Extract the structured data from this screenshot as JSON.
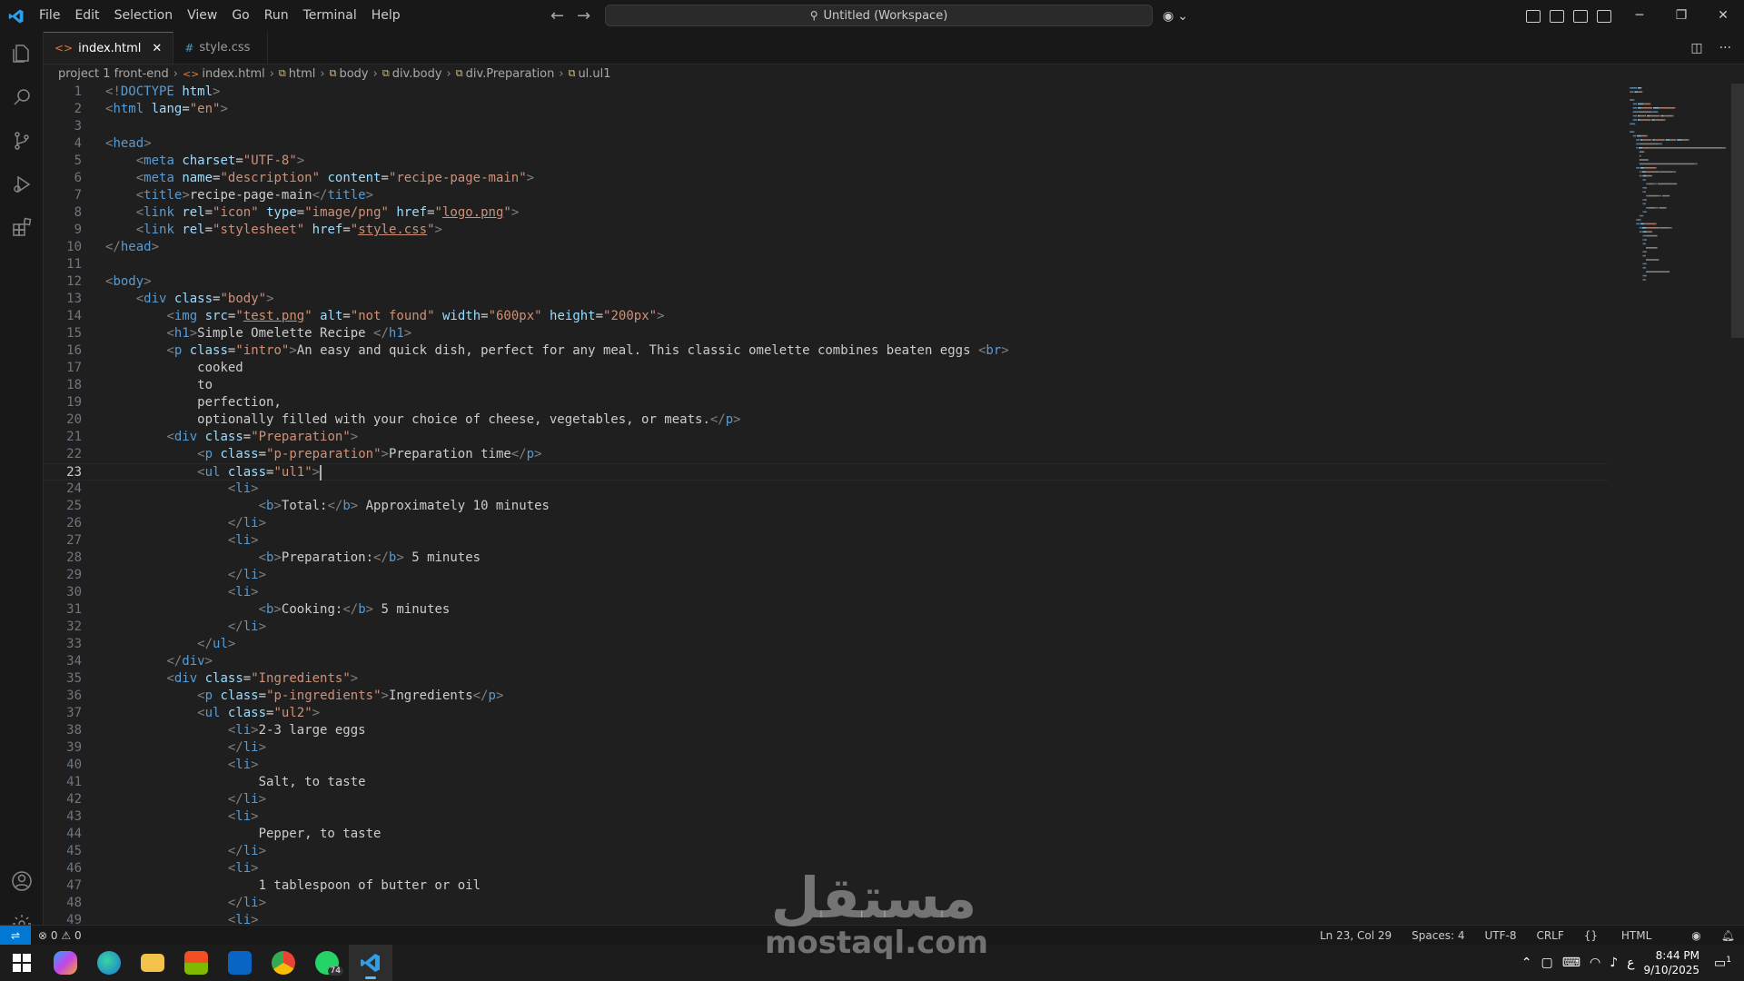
{
  "menu": [
    "File",
    "Edit",
    "Selection",
    "View",
    "Go",
    "Run",
    "Terminal",
    "Help"
  ],
  "command_center": "Untitled (Workspace)",
  "tabs": [
    {
      "label": "index.html",
      "icon": "html-file-icon",
      "active": true
    },
    {
      "label": "style.css",
      "icon": "css-file-icon",
      "active": false
    }
  ],
  "breadcrumb": [
    "project 1 front-end",
    "index.html",
    "html",
    "body",
    "div.body",
    "div.Preparation",
    "ul.ul1"
  ],
  "editor": {
    "cursor_line": 23,
    "lines": [
      [
        [
          "brk",
          "<!"
        ],
        [
          "tag",
          "DOCTYPE"
        ],
        [
          "txt",
          " "
        ],
        [
          "attr",
          "html"
        ],
        [
          "brk",
          ">"
        ]
      ],
      [
        [
          "brk",
          "<"
        ],
        [
          "tag",
          "html"
        ],
        [
          "txt",
          " "
        ],
        [
          "attr",
          "lang"
        ],
        [
          "txt",
          "="
        ],
        [
          "str",
          "\"en\""
        ],
        [
          "brk",
          ">"
        ]
      ],
      [],
      [
        [
          "brk",
          "<"
        ],
        [
          "tag",
          "head"
        ],
        [
          "brk",
          ">"
        ]
      ],
      [
        [
          "txt",
          "    "
        ],
        [
          "brk",
          "<"
        ],
        [
          "tag",
          "meta"
        ],
        [
          "txt",
          " "
        ],
        [
          "attr",
          "charset"
        ],
        [
          "txt",
          "="
        ],
        [
          "str",
          "\"UTF-8\""
        ],
        [
          "brk",
          ">"
        ]
      ],
      [
        [
          "txt",
          "    "
        ],
        [
          "brk",
          "<"
        ],
        [
          "tag",
          "meta"
        ],
        [
          "txt",
          " "
        ],
        [
          "attr",
          "name"
        ],
        [
          "txt",
          "="
        ],
        [
          "str",
          "\"description\""
        ],
        [
          "txt",
          " "
        ],
        [
          "attr",
          "content"
        ],
        [
          "txt",
          "="
        ],
        [
          "str",
          "\"recipe-page-main\""
        ],
        [
          "brk",
          ">"
        ]
      ],
      [
        [
          "txt",
          "    "
        ],
        [
          "brk",
          "<"
        ],
        [
          "tag",
          "title"
        ],
        [
          "brk",
          ">"
        ],
        [
          "txt",
          "recipe-page-main"
        ],
        [
          "brk",
          "</"
        ],
        [
          "tag",
          "title"
        ],
        [
          "brk",
          ">"
        ]
      ],
      [
        [
          "txt",
          "    "
        ],
        [
          "brk",
          "<"
        ],
        [
          "tag",
          "link"
        ],
        [
          "txt",
          " "
        ],
        [
          "attr",
          "rel"
        ],
        [
          "txt",
          "="
        ],
        [
          "str",
          "\"icon\""
        ],
        [
          "txt",
          " "
        ],
        [
          "attr",
          "type"
        ],
        [
          "txt",
          "="
        ],
        [
          "str",
          "\"image/png\""
        ],
        [
          "txt",
          " "
        ],
        [
          "attr",
          "href"
        ],
        [
          "txt",
          "="
        ],
        [
          "str",
          "\""
        ],
        [
          "link",
          "logo.png"
        ],
        [
          "str",
          "\""
        ],
        [
          "brk",
          ">"
        ]
      ],
      [
        [
          "txt",
          "    "
        ],
        [
          "brk",
          "<"
        ],
        [
          "tag",
          "link"
        ],
        [
          "txt",
          " "
        ],
        [
          "attr",
          "rel"
        ],
        [
          "txt",
          "="
        ],
        [
          "str",
          "\"stylesheet\""
        ],
        [
          "txt",
          " "
        ],
        [
          "attr",
          "href"
        ],
        [
          "txt",
          "="
        ],
        [
          "str",
          "\""
        ],
        [
          "link",
          "style.css"
        ],
        [
          "str",
          "\""
        ],
        [
          "brk",
          ">"
        ]
      ],
      [
        [
          "brk",
          "</"
        ],
        [
          "tag",
          "head"
        ],
        [
          "brk",
          ">"
        ]
      ],
      [],
      [
        [
          "brk",
          "<"
        ],
        [
          "tag",
          "body"
        ],
        [
          "brk",
          ">"
        ]
      ],
      [
        [
          "txt",
          "    "
        ],
        [
          "brk",
          "<"
        ],
        [
          "tag",
          "div"
        ],
        [
          "txt",
          " "
        ],
        [
          "attr",
          "class"
        ],
        [
          "txt",
          "="
        ],
        [
          "str",
          "\"body\""
        ],
        [
          "brk",
          ">"
        ]
      ],
      [
        [
          "txt",
          "        "
        ],
        [
          "brk",
          "<"
        ],
        [
          "tag",
          "img"
        ],
        [
          "txt",
          " "
        ],
        [
          "attr",
          "src"
        ],
        [
          "txt",
          "="
        ],
        [
          "str",
          "\""
        ],
        [
          "link",
          "test.png"
        ],
        [
          "str",
          "\""
        ],
        [
          "txt",
          " "
        ],
        [
          "attr",
          "alt"
        ],
        [
          "txt",
          "="
        ],
        [
          "str",
          "\"not found\""
        ],
        [
          "txt",
          " "
        ],
        [
          "attr",
          "width"
        ],
        [
          "txt",
          "="
        ],
        [
          "str",
          "\"600px\""
        ],
        [
          "txt",
          " "
        ],
        [
          "attr",
          "height"
        ],
        [
          "txt",
          "="
        ],
        [
          "str",
          "\"200px\""
        ],
        [
          "brk",
          ">"
        ]
      ],
      [
        [
          "txt",
          "        "
        ],
        [
          "brk",
          "<"
        ],
        [
          "tag",
          "h1"
        ],
        [
          "brk",
          ">"
        ],
        [
          "txt",
          "Simple Omelette Recipe "
        ],
        [
          "brk",
          "</"
        ],
        [
          "tag",
          "h1"
        ],
        [
          "brk",
          ">"
        ]
      ],
      [
        [
          "txt",
          "        "
        ],
        [
          "brk",
          "<"
        ],
        [
          "tag",
          "p"
        ],
        [
          "txt",
          " "
        ],
        [
          "attr",
          "class"
        ],
        [
          "txt",
          "="
        ],
        [
          "str",
          "\"intro\""
        ],
        [
          "brk",
          ">"
        ],
        [
          "txt",
          "An easy and quick dish, perfect for any meal. This classic omelette combines beaten eggs "
        ],
        [
          "brk",
          "<"
        ],
        [
          "tag",
          "br"
        ],
        [
          "brk",
          ">"
        ]
      ],
      [
        [
          "txt",
          "            cooked"
        ]
      ],
      [
        [
          "txt",
          "            to"
        ]
      ],
      [
        [
          "txt",
          "            perfection,"
        ]
      ],
      [
        [
          "txt",
          "            optionally filled with your choice of cheese, vegetables, or meats."
        ],
        [
          "brk",
          "</"
        ],
        [
          "tag",
          "p"
        ],
        [
          "brk",
          ">"
        ]
      ],
      [
        [
          "txt",
          "        "
        ],
        [
          "brk",
          "<"
        ],
        [
          "tag",
          "div"
        ],
        [
          "txt",
          " "
        ],
        [
          "attr",
          "class"
        ],
        [
          "txt",
          "="
        ],
        [
          "str",
          "\"Preparation\""
        ],
        [
          "brk",
          ">"
        ]
      ],
      [
        [
          "txt",
          "            "
        ],
        [
          "brk",
          "<"
        ],
        [
          "tag",
          "p"
        ],
        [
          "txt",
          " "
        ],
        [
          "attr",
          "class"
        ],
        [
          "txt",
          "="
        ],
        [
          "str",
          "\"p-preparation\""
        ],
        [
          "brk",
          ">"
        ],
        [
          "txt",
          "Preparation time"
        ],
        [
          "brk",
          "</"
        ],
        [
          "tag",
          "p"
        ],
        [
          "brk",
          ">"
        ]
      ],
      [
        [
          "txt",
          "            "
        ],
        [
          "brk",
          "<"
        ],
        [
          "tag",
          "ul"
        ],
        [
          "txt",
          " "
        ],
        [
          "attr",
          "class"
        ],
        [
          "txt",
          "="
        ],
        [
          "str",
          "\"ul1\""
        ],
        [
          "brk",
          ">"
        ]
      ],
      [
        [
          "txt",
          "                "
        ],
        [
          "brk",
          "<"
        ],
        [
          "tag",
          "li"
        ],
        [
          "brk",
          ">"
        ]
      ],
      [
        [
          "txt",
          "                    "
        ],
        [
          "brk",
          "<"
        ],
        [
          "tag",
          "b"
        ],
        [
          "brk",
          ">"
        ],
        [
          "txt",
          "Total:"
        ],
        [
          "brk",
          "</"
        ],
        [
          "tag",
          "b"
        ],
        [
          "brk",
          ">"
        ],
        [
          "txt",
          " Approximately 10 minutes"
        ]
      ],
      [
        [
          "txt",
          "                "
        ],
        [
          "brk",
          "</"
        ],
        [
          "tag",
          "li"
        ],
        [
          "brk",
          ">"
        ]
      ],
      [
        [
          "txt",
          "                "
        ],
        [
          "brk",
          "<"
        ],
        [
          "tag",
          "li"
        ],
        [
          "brk",
          ">"
        ]
      ],
      [
        [
          "txt",
          "                    "
        ],
        [
          "brk",
          "<"
        ],
        [
          "tag",
          "b"
        ],
        [
          "brk",
          ">"
        ],
        [
          "txt",
          "Preparation:"
        ],
        [
          "brk",
          "</"
        ],
        [
          "tag",
          "b"
        ],
        [
          "brk",
          ">"
        ],
        [
          "txt",
          " 5 minutes"
        ]
      ],
      [
        [
          "txt",
          "                "
        ],
        [
          "brk",
          "</"
        ],
        [
          "tag",
          "li"
        ],
        [
          "brk",
          ">"
        ]
      ],
      [
        [
          "txt",
          "                "
        ],
        [
          "brk",
          "<"
        ],
        [
          "tag",
          "li"
        ],
        [
          "brk",
          ">"
        ]
      ],
      [
        [
          "txt",
          "                    "
        ],
        [
          "brk",
          "<"
        ],
        [
          "tag",
          "b"
        ],
        [
          "brk",
          ">"
        ],
        [
          "txt",
          "Cooking:"
        ],
        [
          "brk",
          "</"
        ],
        [
          "tag",
          "b"
        ],
        [
          "brk",
          ">"
        ],
        [
          "txt",
          " 5 minutes"
        ]
      ],
      [
        [
          "txt",
          "                "
        ],
        [
          "brk",
          "</"
        ],
        [
          "tag",
          "li"
        ],
        [
          "brk",
          ">"
        ]
      ],
      [
        [
          "txt",
          "            "
        ],
        [
          "brk",
          "</"
        ],
        [
          "tag",
          "ul"
        ],
        [
          "brk",
          ">"
        ]
      ],
      [
        [
          "txt",
          "        "
        ],
        [
          "brk",
          "</"
        ],
        [
          "tag",
          "div"
        ],
        [
          "brk",
          ">"
        ]
      ],
      [
        [
          "txt",
          "        "
        ],
        [
          "brk",
          "<"
        ],
        [
          "tag",
          "div"
        ],
        [
          "txt",
          " "
        ],
        [
          "attr",
          "class"
        ],
        [
          "txt",
          "="
        ],
        [
          "str",
          "\"Ingredients\""
        ],
        [
          "brk",
          ">"
        ]
      ],
      [
        [
          "txt",
          "            "
        ],
        [
          "brk",
          "<"
        ],
        [
          "tag",
          "p"
        ],
        [
          "txt",
          " "
        ],
        [
          "attr",
          "class"
        ],
        [
          "txt",
          "="
        ],
        [
          "str",
          "\"p-ingredients\""
        ],
        [
          "brk",
          ">"
        ],
        [
          "txt",
          "Ingredients"
        ],
        [
          "brk",
          "</"
        ],
        [
          "tag",
          "p"
        ],
        [
          "brk",
          ">"
        ]
      ],
      [
        [
          "txt",
          "            "
        ],
        [
          "brk",
          "<"
        ],
        [
          "tag",
          "ul"
        ],
        [
          "txt",
          " "
        ],
        [
          "attr",
          "class"
        ],
        [
          "txt",
          "="
        ],
        [
          "str",
          "\"ul2\""
        ],
        [
          "brk",
          ">"
        ]
      ],
      [
        [
          "txt",
          "                "
        ],
        [
          "brk",
          "<"
        ],
        [
          "tag",
          "li"
        ],
        [
          "brk",
          ">"
        ],
        [
          "txt",
          "2-3 large eggs"
        ]
      ],
      [
        [
          "txt",
          "                "
        ],
        [
          "brk",
          "</"
        ],
        [
          "tag",
          "li"
        ],
        [
          "brk",
          ">"
        ]
      ],
      [
        [
          "txt",
          "                "
        ],
        [
          "brk",
          "<"
        ],
        [
          "tag",
          "li"
        ],
        [
          "brk",
          ">"
        ]
      ],
      [
        [
          "txt",
          "                    Salt, to taste"
        ]
      ],
      [
        [
          "txt",
          "                "
        ],
        [
          "brk",
          "</"
        ],
        [
          "tag",
          "li"
        ],
        [
          "brk",
          ">"
        ]
      ],
      [
        [
          "txt",
          "                "
        ],
        [
          "brk",
          "<"
        ],
        [
          "tag",
          "li"
        ],
        [
          "brk",
          ">"
        ]
      ],
      [
        [
          "txt",
          "                    Pepper, to taste"
        ]
      ],
      [
        [
          "txt",
          "                "
        ],
        [
          "brk",
          "</"
        ],
        [
          "tag",
          "li"
        ],
        [
          "brk",
          ">"
        ]
      ],
      [
        [
          "txt",
          "                "
        ],
        [
          "brk",
          "<"
        ],
        [
          "tag",
          "li"
        ],
        [
          "brk",
          ">"
        ]
      ],
      [
        [
          "txt",
          "                    1 tablespoon of butter or oil"
        ]
      ],
      [
        [
          "txt",
          "                "
        ],
        [
          "brk",
          "</"
        ],
        [
          "tag",
          "li"
        ],
        [
          "brk",
          ">"
        ]
      ],
      [
        [
          "txt",
          "                "
        ],
        [
          "brk",
          "<"
        ],
        [
          "tag",
          "li"
        ],
        [
          "brk",
          ">"
        ]
      ]
    ]
  },
  "status": {
    "errors": "0",
    "warnings": "0",
    "position": "Ln 23, Col 29",
    "spaces": "Spaces: 4",
    "encoding": "UTF-8",
    "eol": "CRLF",
    "language": "HTML"
  },
  "taskbar": {
    "whatsapp_badge": "74",
    "time": "8:44 PM",
    "date": "9/10/2025",
    "notifications": "1"
  },
  "watermark": {
    "arabic": "مستقل",
    "latin": "mostaql.com"
  },
  "colors": {
    "accent": "#0078d4",
    "editor_bg": "#1f1f1f",
    "tag": "#569cd6",
    "attr": "#9cdcfe",
    "string": "#ce9178"
  }
}
